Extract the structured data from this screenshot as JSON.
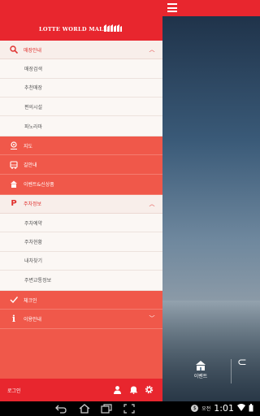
{
  "app": {
    "logo_text": "LOTTE WORLD MALL"
  },
  "menu": {
    "section1": {
      "label": "매장안내",
      "icon": "search-icon"
    },
    "section1_items": [
      "매장검색",
      "추천매장",
      "편의시설",
      "파노라마"
    ],
    "items_a": [
      {
        "label": "지도",
        "icon": "map-pin-icon"
      },
      {
        "label": "길안내",
        "icon": "bus-icon"
      },
      {
        "label": "이벤트&신상품",
        "icon": "event-icon"
      }
    ],
    "section2": {
      "label": "주차정보",
      "icon": "parking-icon"
    },
    "section2_items": [
      "주차예약",
      "주차현황",
      "내차찾기",
      "주변교통정보"
    ],
    "items_b": [
      {
        "label": "체크인",
        "icon": "check-icon"
      },
      {
        "label": "이용안내",
        "icon": "info-icon"
      }
    ]
  },
  "footer": {
    "login_label": "로그인"
  },
  "bottom_tab": {
    "event_label": "이벤트"
  },
  "statusbar": {
    "ampm": "오전",
    "time": "1:01"
  },
  "colors": {
    "accent": "#e8262e",
    "drawer_bg": "#f0584a",
    "sub_bg": "#fbf7f4"
  }
}
